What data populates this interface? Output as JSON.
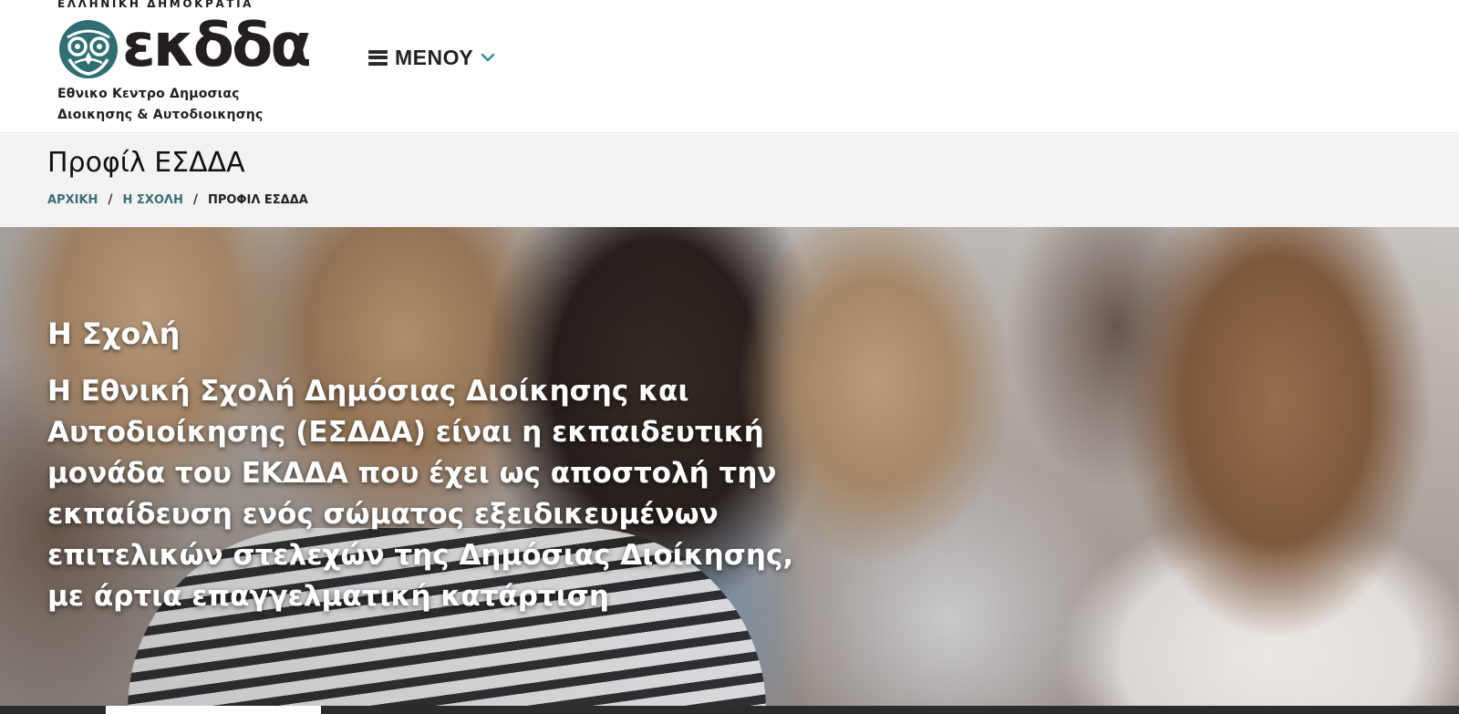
{
  "header": {
    "logo": {
      "republic": "ΕΛΛΗΝΙΚΗ ΔΗΜΟΚΡΑΤΙΑ",
      "wordmark": "εκδδα",
      "line1": "Εθνικο Κεντρο Δημοσιας",
      "line2": "Διοικησης & Αυτοδιοικησης",
      "icon": "owl-emblem-icon"
    },
    "menu": {
      "label": "ΜΕΝΟΥ",
      "icon": "hamburger-icon",
      "chevron": "chevron-down-icon"
    }
  },
  "title_bar": {
    "title": "Προφίλ ΕΣΔΔΑ",
    "breadcrumb": {
      "items": [
        {
          "label": "ΑΡΧΙΚΗ"
        },
        {
          "label": "Η ΣΧΟΛΗ"
        }
      ],
      "separator": "/",
      "current": "ΠΡΟΦΙΛ ΕΣΔΔΑ"
    }
  },
  "hero": {
    "heading": "Η Σχολή",
    "text": "Η Εθνική Σχολή Δημόσιας Διοίκησης και Αυτοδιοίκησης (ΕΣΔΔΑ) είναι η εκπαιδευτική μονάδα του ΕΚΔΔΑ που έχει ως αποστολή την εκπαίδευση ενός σώματος εξειδικευμένων επιτελικών στελεχών της Δημόσιας Διοίκησης, με άρτια επαγγελματική κατάρτιση"
  },
  "colors": {
    "brand_teal": "#2f6f73",
    "breadcrumb_link": "#3b6e76",
    "title_bar_bg": "#f2f2f2",
    "tab_strip": "#2c2c2c"
  }
}
